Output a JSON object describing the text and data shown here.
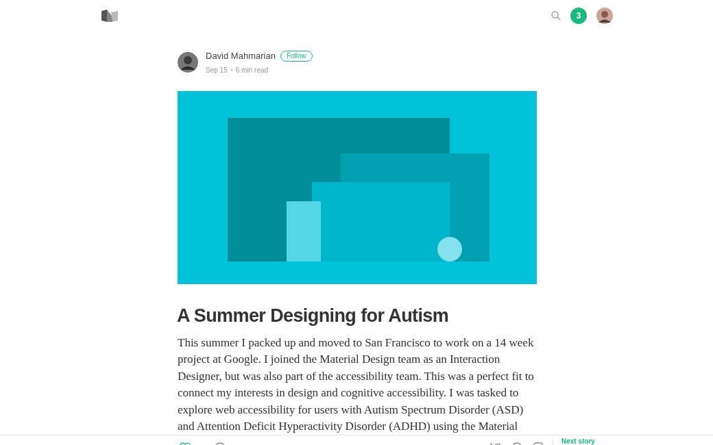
{
  "header": {
    "notification_count": "3"
  },
  "author": {
    "name": "David Mahmarian",
    "follow": "Follow",
    "date": "Sep 15",
    "read_time": "6 min read"
  },
  "article": {
    "title": "A Summer Designing for Autism",
    "paragraph": "This summer I packed up and moved to San Francisco to work on a 14 week project at Google. I joined the Material Design team as an Interaction Designer, but was also part of the accessibility team. This was a perfect fit to connect my interests in design and cognitive accessibility. I was tasked to explore web accessibility for users with Autism Spectrum Disorder (ASD) and Attention Deficit Hyperactivity Disorder (ADHD) using the Material"
  },
  "bottom_bar": {
    "next_story": "Next story"
  }
}
